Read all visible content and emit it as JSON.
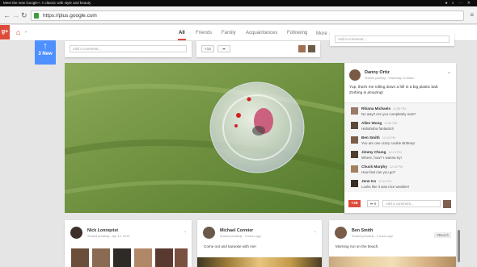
{
  "video_bar": {
    "title": "Meet the new Google+: A classic with style and beauty"
  },
  "browser": {
    "url": "https://plus.google.com",
    "back": "←",
    "forward": "→",
    "reload": "↻",
    "menu": "≡"
  },
  "header": {
    "logo": "g+",
    "tabs": [
      {
        "label": "All",
        "active": true
      },
      {
        "label": "Friends"
      },
      {
        "label": "Family"
      },
      {
        "label": "Acquaintances"
      },
      {
        "label": "Following"
      },
      {
        "label": "More"
      }
    ]
  },
  "new_posts": {
    "label": "3 New",
    "arrow": "↑"
  },
  "top_cards": {
    "comment_placeholder": "Add a comment...",
    "plus_count": "+14",
    "card3_comment_placeholder": "Add a comment..."
  },
  "post": {
    "author": "Danny Ortiz",
    "meta": "Shared publicly - Yesterday 11:55am",
    "text": "Yup, that's me rolling down a hill in a big plastic ball. Zorbing is amazing!",
    "plus_count": "+28",
    "share_count": "6",
    "comment_placeholder": "Add a comment...",
    "comments": [
      {
        "name": "Rhiana Michaels",
        "time": "11:55 PM",
        "text": "No way!! Are you completely nuts?"
      },
      {
        "name": "Allen Wong",
        "time": "11:55 PM",
        "text": "Hahahaha fantastic!!"
      },
      {
        "name": "Ben Smith",
        "time": "12:10 PM",
        "text": "You are one crazy cookie Brittney!"
      },
      {
        "name": "Jimmy Chung",
        "time": "12:14 PM",
        "text": "Where, how? I wanna try!"
      },
      {
        "name": "Chuck Murphy",
        "time": "12:15 PM",
        "text": "How fast can you go?"
      },
      {
        "name": "Jenn Ko",
        "time": "12:15 PM",
        "text": "Looks like it was nice weather!"
      }
    ]
  },
  "bottom_cards": [
    {
      "name": "Nick Lonnqvist",
      "meta": "Shared privately - Apr 19, 2013",
      "text": ""
    },
    {
      "name": "Michael Cormier",
      "meta": "Shared privately - 3 hours ago",
      "text": "Come out and karaoke with me!"
    },
    {
      "name": "Ben Smith",
      "meta": "Shared privately - 3 hours ago",
      "text": "Morning run on the beach.",
      "tag": "#Beach"
    }
  ],
  "colors": {
    "brand_red": "#dd4b39",
    "accent_blue": "#4d90fe",
    "ssl_green": "#3c9d3c"
  }
}
